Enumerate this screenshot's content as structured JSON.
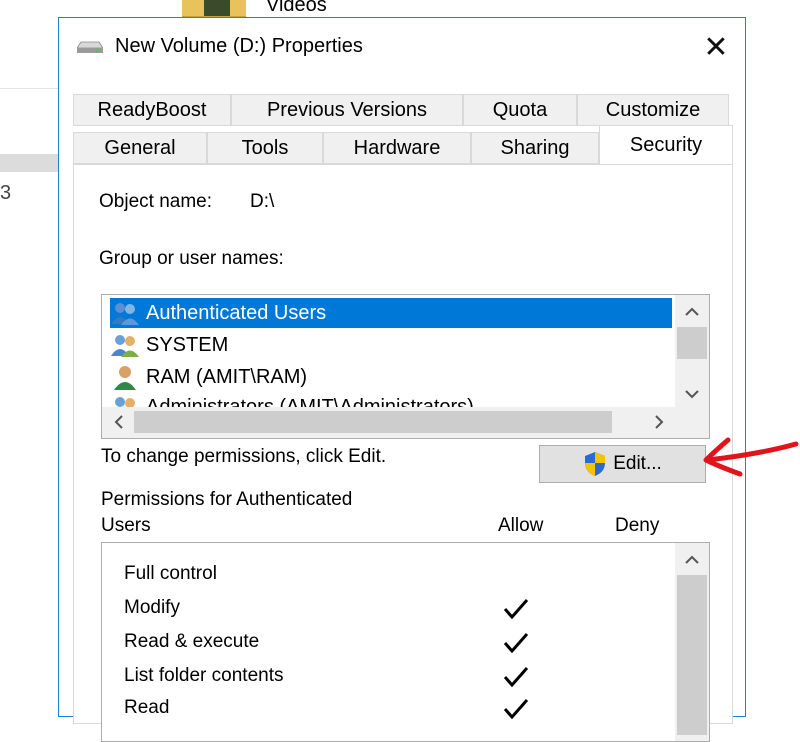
{
  "background": {
    "videos_label": "Videos",
    "side_text": "3"
  },
  "dialog": {
    "title": "New Volume (D:) Properties",
    "close_glyph": "✕"
  },
  "tabs": {
    "row1": [
      "ReadyBoost",
      "Previous Versions",
      "Quota",
      "Customize"
    ],
    "row2": [
      "General",
      "Tools",
      "Hardware",
      "Sharing",
      "Security"
    ],
    "selected": "Security"
  },
  "security": {
    "object_name_label": "Object name:",
    "object_name_value": "D:\\",
    "group_label": "Group or user names:",
    "users": [
      {
        "name": "Authenticated Users",
        "icon": "users-group-icon",
        "selected": true
      },
      {
        "name": "SYSTEM",
        "icon": "users-group-icon",
        "selected": false
      },
      {
        "name": "RAM (AMIT\\RAM)",
        "icon": "single-user-icon",
        "selected": false
      },
      {
        "name": "Administrators (AMIT\\Administrators)",
        "icon": "users-group-icon",
        "selected": false
      }
    ],
    "change_hint": "To change permissions, click Edit.",
    "edit_label": "Edit...",
    "permissions_label_line1": "Permissions for Authenticated",
    "permissions_label_line2": "Users",
    "allow_header": "Allow",
    "deny_header": "Deny",
    "permissions": [
      {
        "name": "Full control",
        "allow": false
      },
      {
        "name": "Modify",
        "allow": true
      },
      {
        "name": "Read & execute",
        "allow": true
      },
      {
        "name": "List folder contents",
        "allow": true
      },
      {
        "name": "Read",
        "allow": true
      }
    ]
  },
  "colors": {
    "selection": "#0078d7",
    "border": "#1883d7",
    "annotation_arrow": "#e0151b"
  }
}
